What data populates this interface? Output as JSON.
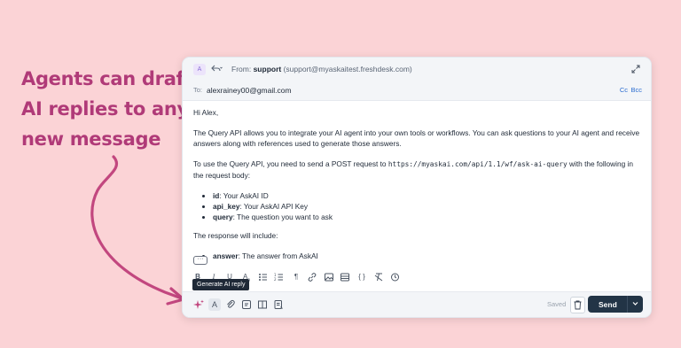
{
  "promo": {
    "lines": [
      "Agents can draft",
      "AI replies to any",
      "new message"
    ]
  },
  "colors": {
    "background": "#fbd3d6",
    "promo_text": "#b03a78",
    "send_button": "#223446",
    "link": "#2b6cd0"
  },
  "email": {
    "avatar_letter": "A",
    "from_label": "From:",
    "from_name": "support",
    "from_address": "(support@myaskaitest.freshdesk.com)",
    "to_label": "To:",
    "to_value": "alexrainey00@gmail.com",
    "cc": "Cc",
    "bcc": "Bcc",
    "greeting": "Hi Alex,",
    "para1": "The Query API allows you to integrate your AI agent into your own tools or workflows. You can ask questions to your AI agent and receive answers along with references used to generate those answers.",
    "para2_before": "To use the Query API, you need to send a POST request to ",
    "para2_url": "https://myaskai.com/api/1.1/wf/ask-ai-query",
    "para2_after": " with the following in the request body:",
    "bullets": [
      {
        "key": "id",
        "text": ": Your AskAI ID"
      },
      {
        "key": "api_key",
        "text": ": Your AskAI API Key"
      },
      {
        "key": "query",
        "text": ": The question you want to ask"
      }
    ],
    "response_intro": "The response will include:",
    "response_bullet_key": "answer",
    "response_bullet_text": ": The answer from AskAI"
  },
  "toolbar": {
    "tooltip": "Generate AI reply"
  },
  "footer": {
    "saved": "Saved",
    "send": "Send"
  },
  "icons": [
    "reply-all-icon",
    "expand-icon",
    "bold-icon",
    "italic-icon",
    "underline-icon",
    "font-size-icon",
    "bullet-list-icon",
    "numbered-list-icon",
    "paragraph-icon",
    "link-icon",
    "image-icon",
    "table-icon",
    "code-icon",
    "clear-format-icon",
    "history-icon",
    "sparkle-icon",
    "text-format-icon",
    "attachment-icon",
    "canned-response-icon",
    "article-icon",
    "template-icon",
    "trash-icon",
    "chevron-down-icon"
  ]
}
